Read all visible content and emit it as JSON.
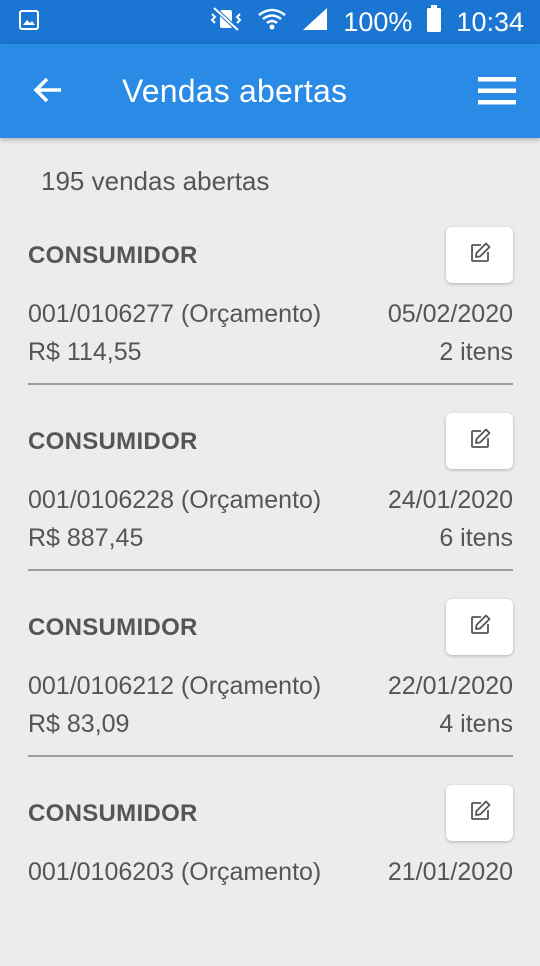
{
  "status_bar": {
    "battery_percent": "100%",
    "time": "10:34",
    "icons": [
      "gallery-notification-icon",
      "vibrate-mute-icon",
      "wifi-icon",
      "cell-signal-icon",
      "battery-icon"
    ]
  },
  "app_bar": {
    "title": "Vendas abertas",
    "back_icon": "arrow-left-icon",
    "menu_icon": "hamburger-menu-icon"
  },
  "summary": {
    "count_text": "195 vendas abertas"
  },
  "sales": [
    {
      "customer": "CONSUMIDOR",
      "order": "001/0106277 (Orçamento)",
      "date": "05/02/2020",
      "total": "R$ 114,55",
      "items": "2 itens"
    },
    {
      "customer": "CONSUMIDOR",
      "order": "001/0106228 (Orçamento)",
      "date": "24/01/2020",
      "total": "R$ 887,45",
      "items": "6 itens"
    },
    {
      "customer": "CONSUMIDOR",
      "order": "001/0106212 (Orçamento)",
      "date": "22/01/2020",
      "total": "R$ 83,09",
      "items": "4 itens"
    },
    {
      "customer": "CONSUMIDOR",
      "order": "001/0106203 (Orçamento)",
      "date": "21/01/2020",
      "total": "",
      "items": ""
    }
  ],
  "colors": {
    "status_bar": "#1a76d2",
    "app_bar": "#2a8be6",
    "background": "#ececec",
    "text": "#555555"
  }
}
